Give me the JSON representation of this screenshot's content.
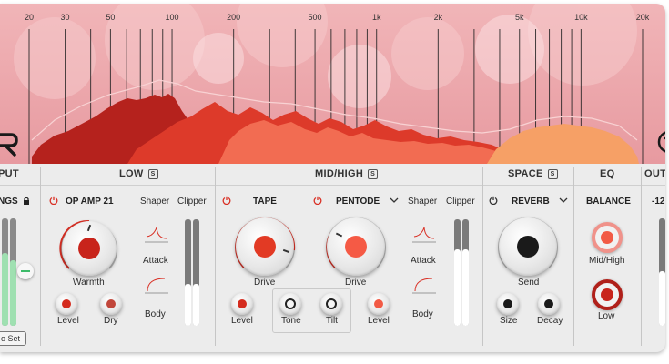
{
  "freq_labels": [
    "20",
    "30",
    "50",
    "100",
    "200",
    "500",
    "1k",
    "2k",
    "5k",
    "10k",
    "20k"
  ],
  "sections": {
    "input": "PUT",
    "low": "LOW",
    "midhigh": "MID/HIGH",
    "space": "SPACE",
    "eq": "EQ",
    "output": "OUT"
  },
  "solo_badge": "S",
  "input_panel": {
    "title": "NGS",
    "auto_set": "o Set"
  },
  "low_module": {
    "name": "OP AMP 21",
    "main_knob": "Warmth",
    "level_knob": "Level",
    "dry_knob": "Dry",
    "shaper_label": "Shaper",
    "clipper_label": "Clipper",
    "attack_label": "Attack",
    "body_label": "Body"
  },
  "tape_module": {
    "name": "TAPE",
    "main_knob": "Drive",
    "level_knob": "Level",
    "tone_knob": "Tone"
  },
  "pentode_module": {
    "name": "PENTODE",
    "main_knob": "Drive",
    "tilt_knob": "Tilt",
    "level_knob": "Level",
    "shaper_label": "Shaper",
    "clipper_label": "Clipper",
    "attack_label": "Attack",
    "body_label": "Body"
  },
  "reverb_module": {
    "name": "REVERB",
    "main_knob": "Send",
    "size_knob": "Size",
    "decay_knob": "Decay"
  },
  "eq_module": {
    "title": "BALANCE",
    "midhigh_knob": "Mid/High",
    "low_knob": "Low"
  },
  "output_panel": {
    "value": "-12."
  },
  "colors": {
    "accent": "#d93025",
    "knob_red": "#d42b1e",
    "knob_coral": "#f25a45",
    "spectrum_bg": "#eda3a8",
    "panel": "#ececec"
  }
}
